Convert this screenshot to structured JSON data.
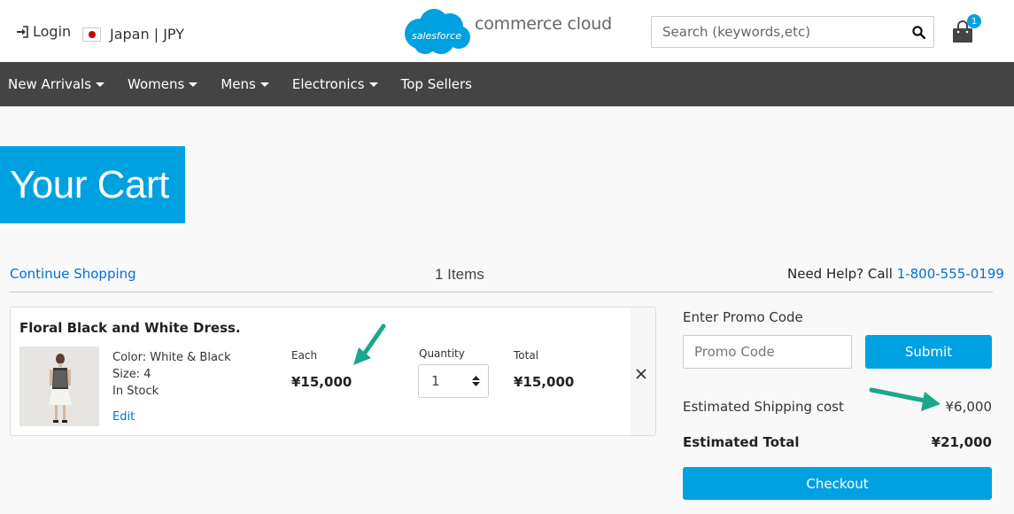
{
  "header": {
    "login_label": "Login",
    "locale_label": "Japan | JPY",
    "logo_brand": "salesforce",
    "logo_text": "commerce cloud",
    "search_placeholder": "Search (keywords,etc)",
    "cart_count": "1"
  },
  "nav": {
    "items": [
      {
        "label": "New Arrivals",
        "dropdown": true
      },
      {
        "label": "Womens",
        "dropdown": true
      },
      {
        "label": "Mens",
        "dropdown": true
      },
      {
        "label": "Electronics",
        "dropdown": true
      },
      {
        "label": "Top Sellers",
        "dropdown": false
      }
    ]
  },
  "page": {
    "title": "Your Cart",
    "continue_label": "Continue Shopping",
    "items_count": "1 Items",
    "help_text": "Need Help? Call",
    "help_phone": "1-800-555-0199"
  },
  "product": {
    "name": "Floral Black and White Dress.",
    "color": "Color: White & Black",
    "size": "Size: 4",
    "stock": "In Stock",
    "edit_label": "Edit",
    "each_label": "Each",
    "each_price": "¥15,000",
    "quantity_label": "Quantity",
    "quantity": "1",
    "total_label": "Total",
    "total_price": "¥15,000",
    "remove_symbol": "×"
  },
  "summary": {
    "promo_label": "Enter Promo Code",
    "promo_placeholder": "Promo Code",
    "submit_label": "Submit",
    "shipping_label": "Estimated Shipping cost",
    "shipping_value": "¥6,000",
    "total_label": "Estimated Total",
    "total_value": "¥21,000",
    "checkout_label": "Checkout"
  },
  "colors": {
    "accent": "#00a1e0",
    "link": "#0070d2",
    "nav_bg": "#444444",
    "annotation_arrow": "#1aa88a"
  }
}
